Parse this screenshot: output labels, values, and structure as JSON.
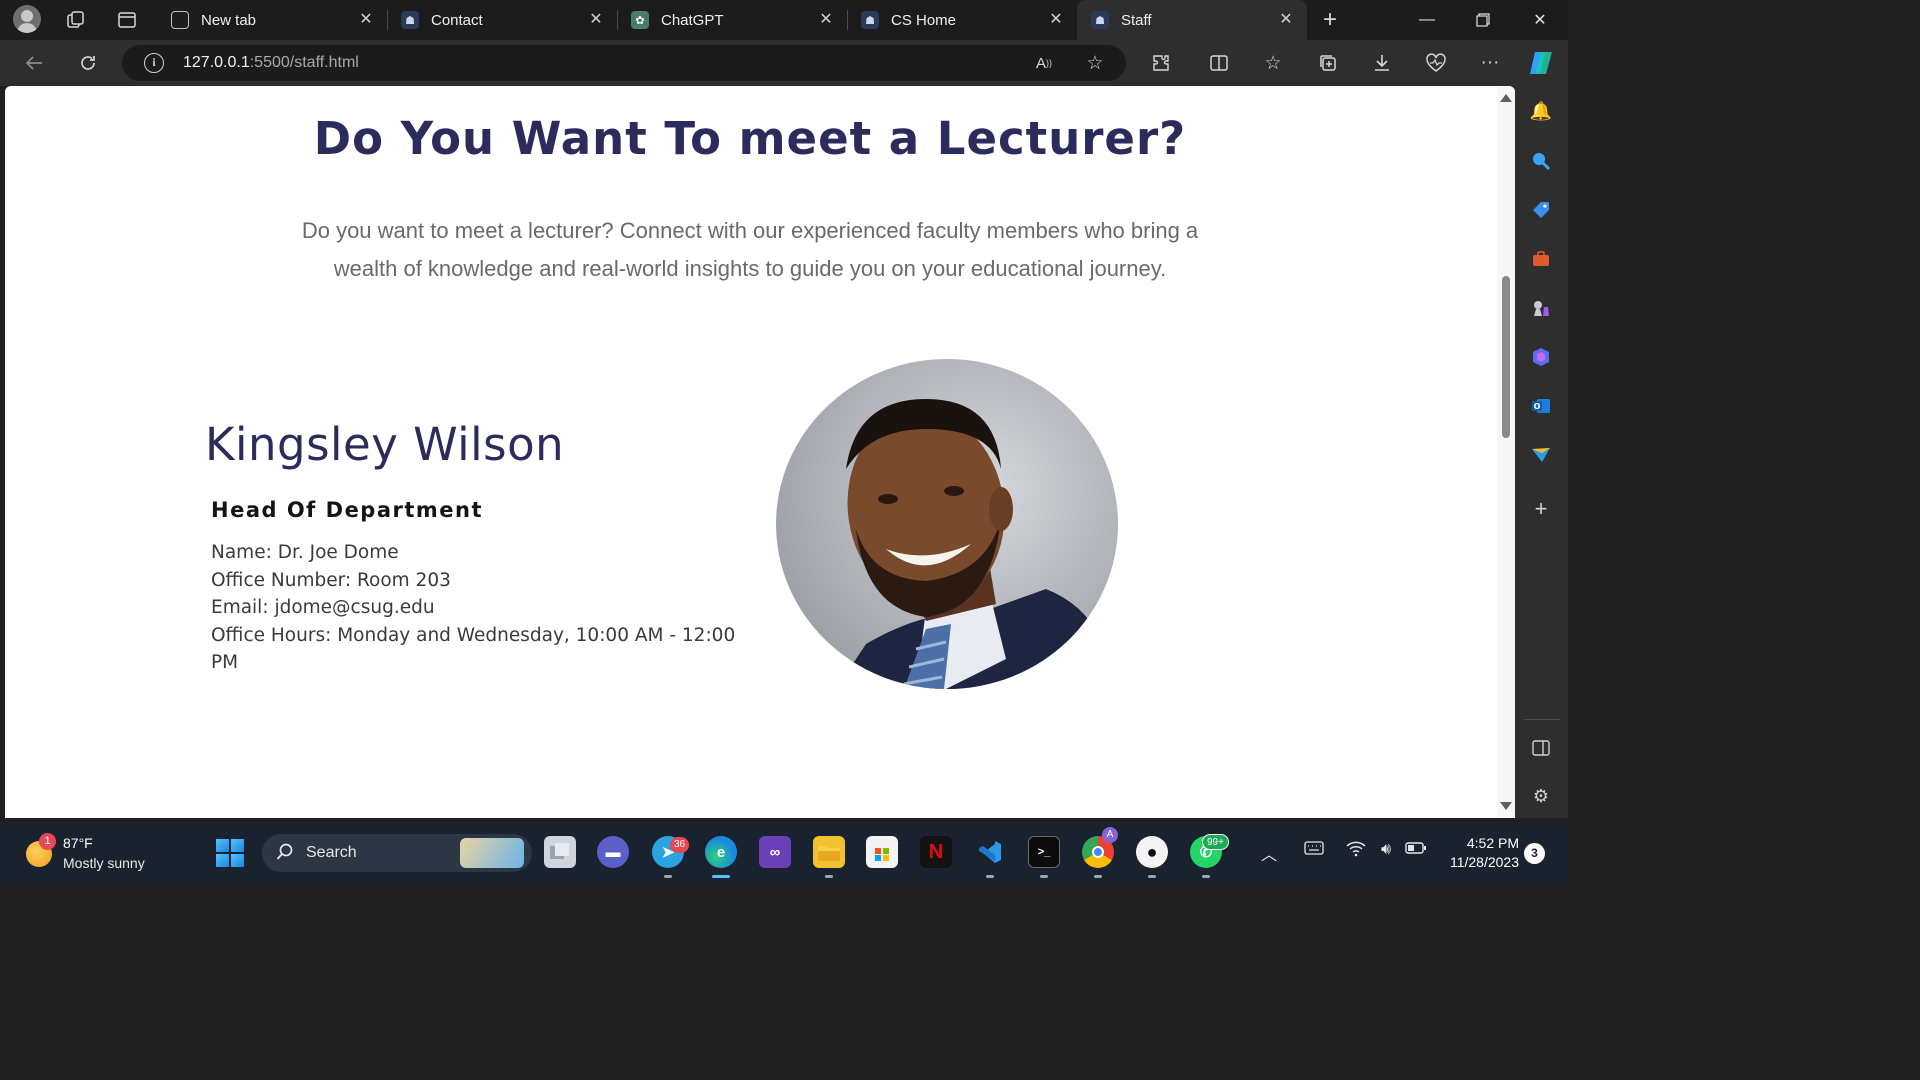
{
  "browser": {
    "tabs": [
      {
        "label": "New tab",
        "icon": "new-tab-icon",
        "active": false
      },
      {
        "label": "Contact",
        "icon": "site-favicon",
        "active": false
      },
      {
        "label": "ChatGPT",
        "icon": "chatgpt-icon",
        "active": false
      },
      {
        "label": "CS Home",
        "icon": "site-favicon",
        "active": false
      },
      {
        "label": "Staff",
        "icon": "site-favicon",
        "active": true
      }
    ],
    "url_host": "127.0.0.1",
    "url_rest": ":5500/staff.html"
  },
  "page": {
    "title": "Do You Want To meet a Lecturer?",
    "intro": "Do you want to meet a lecturer? Connect with our experienced faculty members who bring a wealth of knowledge and real-world insights to guide you on your educational journey.",
    "lecturer": {
      "name": "Kingsley Wilson",
      "role": "Head Of Department",
      "details": [
        "Name: Dr. Joe Dome",
        "Office Number: Room 203",
        "Email: jdome@csug.edu",
        "Office Hours: Monday and Wednesday, 10:00 AM - 12:00 PM"
      ]
    }
  },
  "taskbar": {
    "weather_temp": "87°F",
    "weather_desc": "Mostly sunny",
    "weather_badge": "1",
    "search_label": "Search",
    "telegram_badge": "36",
    "whatsapp_badge": "99+",
    "chrome_badge": "A",
    "time": "4:52 PM",
    "date": "11/28/2023",
    "notification_count": "3"
  },
  "colors": {
    "heading": "#2b2b5c",
    "browser_bg": "#1c1c1c",
    "taskbar_bg": "#1a2230"
  }
}
